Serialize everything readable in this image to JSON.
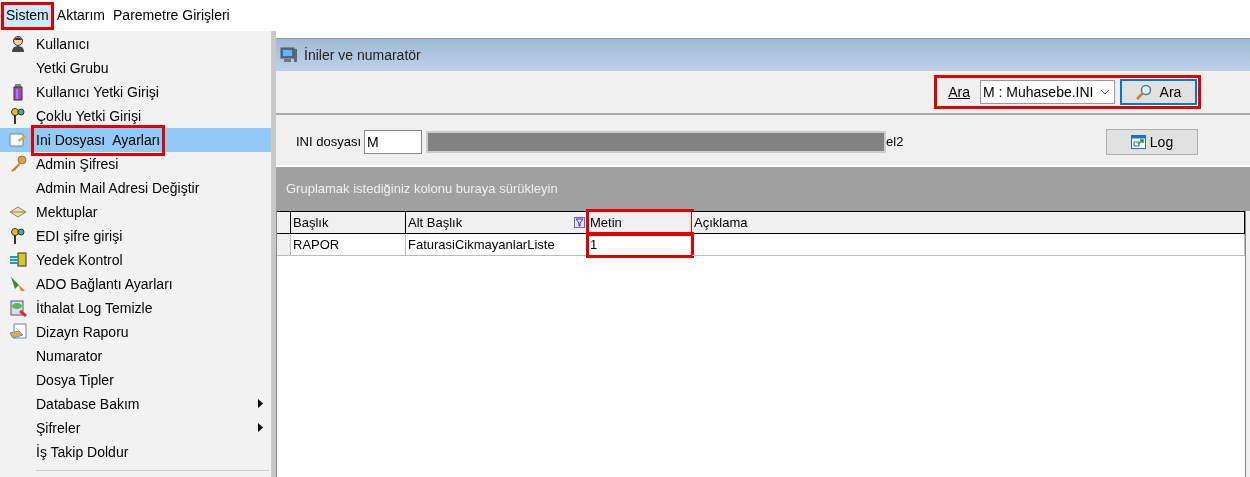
{
  "menu_bar": [
    {
      "label": "Sistem",
      "open": true,
      "highlighted": true
    },
    {
      "label": "Aktarım",
      "open": false,
      "highlighted": false
    },
    {
      "label": "Paremetre Girişleri",
      "open": false,
      "highlighted": false
    }
  ],
  "menu": {
    "items": [
      {
        "label": "Kullanıcı",
        "selected": false,
        "highlighted": false,
        "submenu": false
      },
      {
        "label": "Yetki Grubu",
        "selected": false,
        "highlighted": false,
        "submenu": false
      },
      {
        "label": "Kullanıcı Yetki Girişi",
        "selected": false,
        "highlighted": false,
        "submenu": false
      },
      {
        "label": "Çoklu Yetki Girişi",
        "selected": false,
        "highlighted": false,
        "submenu": false
      },
      {
        "label": "Ini Dosyası  Ayarları",
        "selected": true,
        "highlighted": true,
        "submenu": false
      },
      {
        "label": "Admin Şifresi",
        "selected": false,
        "highlighted": false,
        "submenu": false
      },
      {
        "label": "Admin Mail Adresi Değiştir",
        "selected": false,
        "highlighted": false,
        "submenu": false
      },
      {
        "label": "Mektuplar",
        "selected": false,
        "highlighted": false,
        "submenu": false
      },
      {
        "label": "EDI şifre girişi",
        "selected": false,
        "highlighted": false,
        "submenu": false
      },
      {
        "label": "Yedek Kontrol",
        "selected": false,
        "highlighted": false,
        "submenu": false
      },
      {
        "label": "ADO Bağlantı Ayarları",
        "selected": false,
        "highlighted": false,
        "submenu": false
      },
      {
        "label": "İthalat Log Temizle",
        "selected": false,
        "highlighted": false,
        "submenu": false
      },
      {
        "label": "Dizayn Raporu",
        "selected": false,
        "highlighted": false,
        "submenu": false
      },
      {
        "label": "Numarator",
        "selected": false,
        "highlighted": false,
        "submenu": false
      },
      {
        "label": "Dosya Tipler",
        "selected": false,
        "highlighted": false,
        "submenu": false
      },
      {
        "label": "Database Bakım",
        "selected": false,
        "highlighted": false,
        "submenu": true
      },
      {
        "label": "Şifreler",
        "selected": false,
        "highlighted": false,
        "submenu": true
      },
      {
        "label": "İş Takip Doldur",
        "selected": false,
        "highlighted": false,
        "submenu": false
      }
    ]
  },
  "window": {
    "title": "İniler ve numaratör"
  },
  "search": {
    "label": "Ara",
    "value": "M : Muhasebe.INI",
    "button": "Ara",
    "highlighted": true
  },
  "filter": {
    "label": "INI dosyası",
    "value": "M",
    "trailing_text": "el2",
    "log_button": "Log"
  },
  "group_panel": {
    "hint": "Gruplamak istediğiniz kolonu buraya sürükleyin"
  },
  "table": {
    "columns": [
      {
        "label": "Başlık",
        "filter": false,
        "highlighted": false
      },
      {
        "label": "Alt Başlık",
        "filter": true,
        "highlighted": false
      },
      {
        "label": "Metin",
        "filter": false,
        "highlighted": true
      },
      {
        "label": "Açıklama",
        "filter": false,
        "highlighted": false
      }
    ],
    "rows": [
      {
        "cells": [
          "RAPOR",
          "FaturasiCikmayanlarListe",
          "1",
          ""
        ]
      }
    ]
  }
}
